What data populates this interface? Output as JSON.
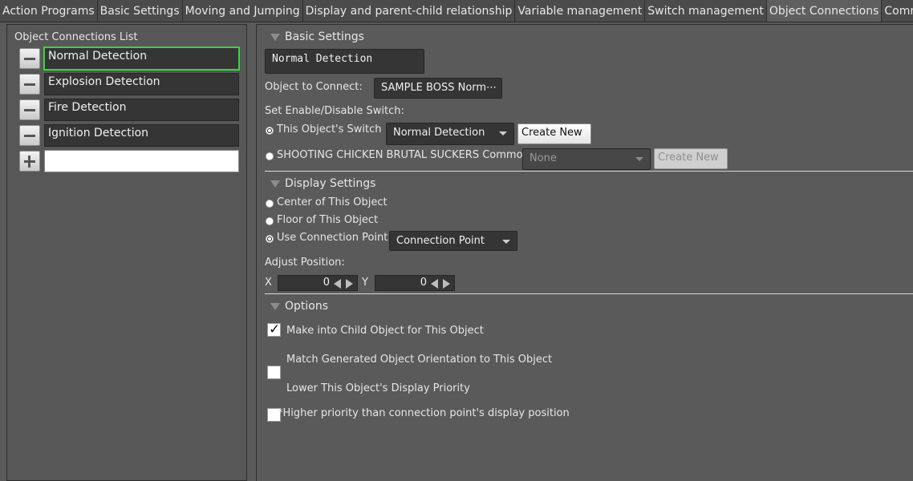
{
  "tabs": [
    {
      "label": "Action Programs"
    },
    {
      "label": "Basic Settings"
    },
    {
      "label": "Moving and Jumping"
    },
    {
      "label": "Display and parent-child relationship"
    },
    {
      "label": "Variable management"
    },
    {
      "label": "Switch management"
    },
    {
      "label": "Object Connections",
      "active": true
    },
    {
      "label": "Common Actions"
    }
  ],
  "left": {
    "title": "Object Connections List",
    "items": [
      {
        "label": "Normal Detection",
        "selected": true
      },
      {
        "label": "Explosion Detection"
      },
      {
        "label": "Fire Detection"
      },
      {
        "label": "Ignition Detection"
      }
    ],
    "new_item_value": ""
  },
  "basic": {
    "header": "Basic Settings",
    "name_value": "Normal Detection",
    "object_to_connect_label": "Object to Connect:",
    "object_to_connect_value": "SAMPLE BOSS Norm⋯",
    "switch_label": "Set Enable/Disable Switch:",
    "this_switch_label": "This Object's Switch",
    "this_switch_value": "Normal Detection",
    "create_new_label": "Create New",
    "common_switch_label": "SHOOTING CHICKEN BRUTAL SUCKERS Common",
    "common_switch_value": "None",
    "create_new_disabled_label": "Create New"
  },
  "display": {
    "header": "Display Settings",
    "center_label": "Center of This Object",
    "floor_label": "Floor of This Object",
    "connection_point_label": "Use Connection Point",
    "connection_point_value": "Connection Point",
    "adjust_label": "Adjust Position:",
    "x_label": "X",
    "x_value": "0",
    "y_label": "Y",
    "y_value": "0"
  },
  "options": {
    "header": "Options",
    "child_label": "Make into Child Object for This Object",
    "child_checked": true,
    "orientation_label": "Match Generated Object Orientation to This Object",
    "orientation_checked": false,
    "lower_priority_label": "Lower This Object's Display Priority",
    "lower_priority_checked": false,
    "note": "*Higher priority than connection point's display position"
  },
  "icons": {
    "checkmark": "✓"
  }
}
